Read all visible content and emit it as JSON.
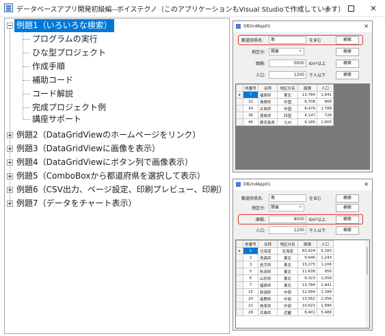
{
  "window": {
    "title": "データベースアプリ開発初級編--ボイステクノ（このアプリケーションもVisual Studioで作成しています）",
    "min_glyph": "—",
    "close_glyph": "✕"
  },
  "tree": {
    "root1": "例題1（いろいろな検索）",
    "children": [
      "プログラムの実行",
      "ひな型プロジェクト",
      "作成手順",
      "補助コード",
      "コード解説",
      "完成プロジェクト例",
      "講座サポート"
    ],
    "others": [
      "例題2（DataGridViewのホームページをリンク）",
      "例題3（DataGridViewに画像を表示）",
      "例題4（DataGridViewにボタン列で画像表示）",
      "例題5（ComboBoxから都道府県を選択して表示）",
      "例題6（CSV出力、ページ設定、印刷プレビュー、印刷）",
      "例題7（データをチャート表示）"
    ]
  },
  "shot1": {
    "title": "DB2ndApp01",
    "close": "✕",
    "pref_label": "都道府県名:",
    "pref_value": "島",
    "contains": "を含む",
    "search": "検索",
    "region_label": "地区分:",
    "region_value": "関東",
    "area_label": "面積:",
    "area_value": "0000",
    "area_suffix": "Km²以上",
    "pop_label": "人口:",
    "pop_value": "1200",
    "pop_suffix": "千人以下",
    "headers": [
      "県番号",
      "名称",
      "地区分名",
      "面積",
      "人口"
    ],
    "rows": [
      [
        "7",
        "福島県",
        "東北",
        "13,784",
        "1,841"
      ],
      [
        "32",
        "島根県",
        "中国",
        "6,708",
        "666"
      ],
      [
        "34",
        "広島県",
        "中国",
        "8,479",
        "2,788"
      ],
      [
        "36",
        "徳島県",
        "四国",
        "4,147",
        "726"
      ],
      [
        "46",
        "鹿児島県",
        "九州",
        "9,186",
        "1,605"
      ]
    ]
  },
  "shot2": {
    "title": "DB2ndApp01",
    "close": "✕",
    "pref_label": "都道府県名:",
    "pref_value": "島",
    "contains": "を含む",
    "search": "検索",
    "region_label": "地区分:",
    "region_value": "関東",
    "area_label": "面積:",
    "area_value": "8000",
    "area_suffix": "Km²以上",
    "pop_label": "人口:",
    "pop_value": "1200",
    "pop_suffix": "千人以下",
    "headers": [
      "県番号",
      "名称",
      "地区分名",
      "面積",
      "人口"
    ],
    "rows": [
      [
        "1",
        "北海道",
        "北海道",
        "83,424",
        "5,183"
      ],
      [
        "2",
        "青森県",
        "東北",
        "9,646",
        "1,243"
      ],
      [
        "3",
        "岩手県",
        "東北",
        "15,275",
        "1,206"
      ],
      [
        "5",
        "秋田県",
        "東北",
        "11,638",
        "956"
      ],
      [
        "6",
        "山形県",
        "東北",
        "9,323",
        "1,059"
      ],
      [
        "7",
        "福島県",
        "東北",
        "13,784",
        "1,841"
      ],
      [
        "15",
        "新潟県",
        "中部",
        "12,584",
        "2,188"
      ],
      [
        "20",
        "長野県",
        "中部",
        "13,562",
        "2,056"
      ],
      [
        "21",
        "岐阜県",
        "中部",
        "10,621",
        "1,996"
      ],
      [
        "28",
        "兵庫県",
        "近畿",
        "8,401",
        "5,488"
      ]
    ]
  }
}
